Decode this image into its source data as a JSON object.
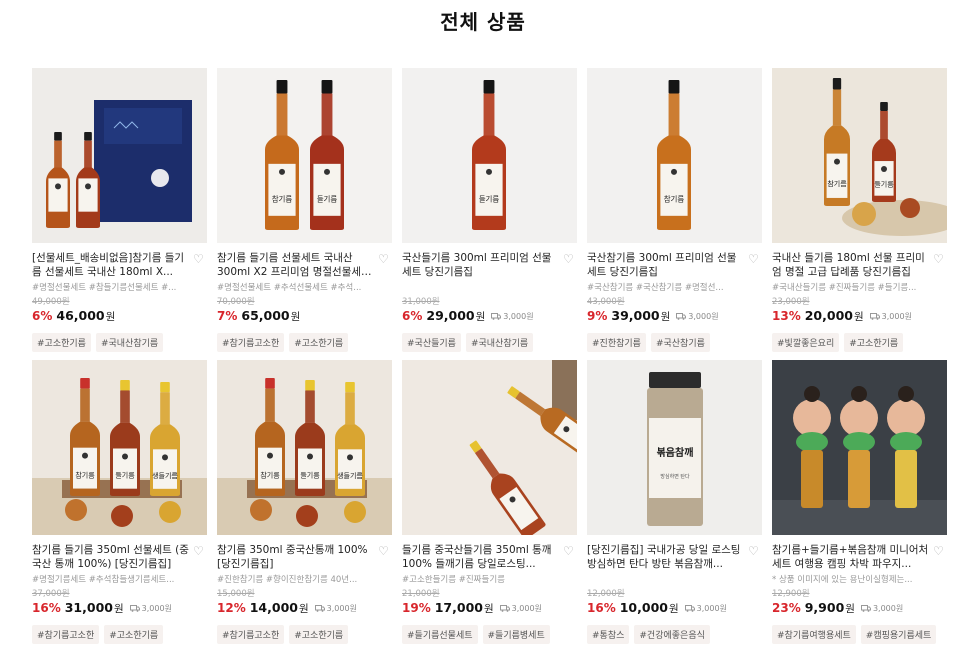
{
  "page": {
    "title": "전체 상품"
  },
  "colors": {
    "discount": "#d8262c",
    "tag_bg": "#f6f1ef",
    "oil_amber": "#c0641e",
    "oil_red": "#a8301a",
    "oil_gold": "#d9a531"
  },
  "products": [
    {
      "name": "[선물세트_배송비없음]참기름 들기름 선물세트 국내산 180ml X...",
      "tags": "#명절선물세트 #참들기름선물세트 #...",
      "original_price": "49,000원",
      "discount": "6%",
      "price": "46,000",
      "won": "원",
      "shipping": "",
      "hashtags": [
        "#고소한기름",
        "#국내산참기름"
      ],
      "image": "gift-box"
    },
    {
      "name": "참기름 들기름 선물세트 국내산 300ml X2 프리미엄 명절선물세트...",
      "tags": "#명절선물세트 #추석선물세트 #추석...",
      "original_price": "70,000원",
      "discount": "7%",
      "price": "65,000",
      "won": "원",
      "shipping": "",
      "hashtags": [
        "#참기름고소한",
        "#고소한기름"
      ],
      "image": "two-bottles"
    },
    {
      "name": "국산들기름 300ml 프리미엄 선물세트 당진기름집",
      "tags": "",
      "original_price": "31,000원",
      "discount": "6%",
      "price": "29,000",
      "won": "원",
      "shipping": "3,000원",
      "hashtags": [
        "#국산들기름",
        "#국내산참기름"
      ],
      "image": "single-red"
    },
    {
      "name": "국산참기름 300ml 프리미엄 선물세트 당진기름집",
      "tags": "#국산참기름 #국산참기름 #명절선...",
      "original_price": "43,000원",
      "discount": "9%",
      "price": "39,000",
      "won": "원",
      "shipping": "3,000원",
      "hashtags": [
        "#진한참기름",
        "#국산참기름"
      ],
      "image": "single-amber"
    },
    {
      "name": "국내산 들기름 180ml 선물 프리미엄 명절 고급 답례품 당진기름집",
      "tags": "#국내산들기름 #진짜들기름 #들기름...",
      "original_price": "23,000원",
      "discount": "13%",
      "price": "20,000",
      "won": "원",
      "shipping": "3,000원",
      "hashtags": [
        "#빛깔좋은요리",
        "#고소한기름"
      ],
      "image": "two-small"
    },
    {
      "name": "참기름 들기름 350ml 선물세트 (중국산 통깨 100%) [당진기름집]",
      "tags": "#명절기름세트 #추석참들생기름세트...",
      "original_price": "37,000원",
      "discount": "16%",
      "price": "31,000",
      "won": "원",
      "shipping": "3,000원",
      "hashtags": [
        "#참기름고소한",
        "#고소한기름"
      ],
      "image": "three-bottles"
    },
    {
      "name": "참기름 350ml 중국산통깨 100% [당진기름집]",
      "tags": "#진한참기름 #향이진한참기름 40년...",
      "original_price": "15,000원",
      "discount": "12%",
      "price": "14,000",
      "won": "원",
      "shipping": "3,000원",
      "hashtags": [
        "#참기름고소한",
        "#고소한기름"
      ],
      "image": "three-bottles-b"
    },
    {
      "name": "들기름 중국산들기름 350ml 통깨 100% 들깨기름 당일로스팅...",
      "tags": "#고소한들기름 #진짜들기름",
      "original_price": "21,000원",
      "discount": "19%",
      "price": "17,000",
      "won": "원",
      "shipping": "3,000원",
      "hashtags": [
        "#들기름선물세트",
        "#들기름병세트"
      ],
      "image": "lying-bottles"
    },
    {
      "name": "[당진기름집] 국내가공 당일 로스팅 방심하면 탄다 방탄 볶음참깨...",
      "tags": "",
      "original_price": "12,000원",
      "discount": "16%",
      "price": "10,000",
      "won": "원",
      "shipping": "3,000원",
      "hashtags": [
        "#통참스",
        "#건강에좋은음식"
      ],
      "image": "sesame-jar",
      "jar_label": "볶음참깨",
      "jar_sub": "방심하면 탄다"
    },
    {
      "name": "참기름+들기름+볶음참깨 미니어처 세트 여행용 캠핑 차박 파우지...",
      "tags": "* 상품 이미지에 있는 용난이실형제는...",
      "original_price": "12,900원",
      "discount": "23%",
      "price": "9,900",
      "won": "원",
      "shipping": "3,000원",
      "hashtags": [
        "#참기름여행용세트",
        "#캠핑용기름세트"
      ],
      "image": "dolls"
    }
  ]
}
